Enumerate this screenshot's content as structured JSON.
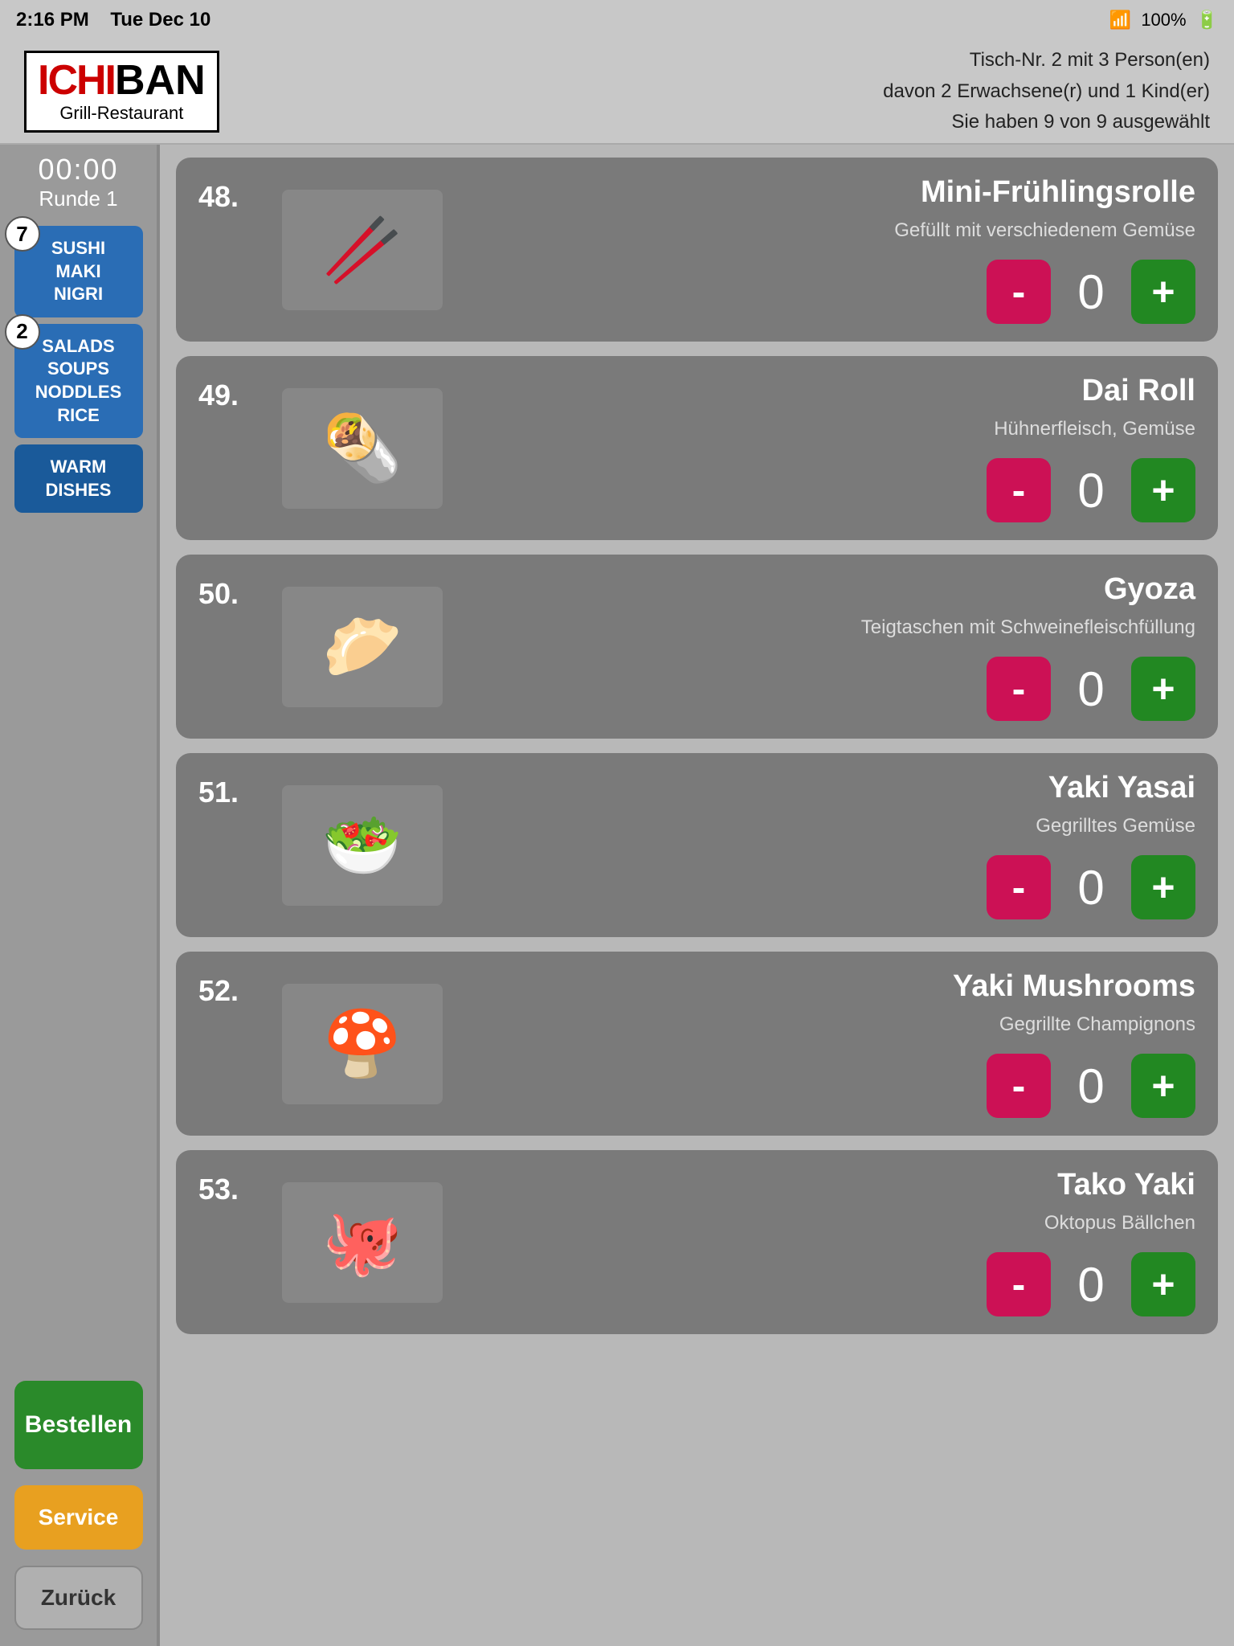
{
  "statusBar": {
    "time": "2:16 PM",
    "date": "Tue Dec 10",
    "wifi": "▲",
    "battery": "100%"
  },
  "header": {
    "logoIchi": "ICHI",
    "logoBan": "BAN",
    "logoSub": "Grill-Restaurant",
    "tableInfo": "Tisch-Nr. 2 mit 3 Person(en)",
    "tableDetails": "davon 2 Erwachsene(r) und 1 Kind(er)",
    "selectionInfo": "Sie haben 9 von 9 ausgewählt"
  },
  "sidebar": {
    "timer": "00:00",
    "round": "Runde 1",
    "categories": [
      {
        "id": "sushi",
        "badge": "7",
        "label": "SUSHI\nMAKI\nNIGRI",
        "active": false
      },
      {
        "id": "salads",
        "badge": "2",
        "label": "SALADS\nSOUPS\nNODDLES\nRICE",
        "active": false
      },
      {
        "id": "warm",
        "badge": "",
        "label": "WARM\nDISHES",
        "active": true
      }
    ],
    "bestellenLabel": "Bestellen",
    "serviceLabel": "Service",
    "zuruckLabel": "Zurück"
  },
  "menuItems": [
    {
      "number": "48.",
      "name": "Mini-Frühlingsrolle",
      "description": "Gefüllt mit verschiedenem Gemüse",
      "quantity": "0",
      "emoji": "🥢"
    },
    {
      "number": "49.",
      "name": "Dai Roll",
      "description": "Hühnerfleisch, Gemüse",
      "quantity": "0",
      "emoji": "🌯"
    },
    {
      "number": "50.",
      "name": "Gyoza",
      "description": "Teigtaschen mit Schweinefleischfüllung",
      "quantity": "0",
      "emoji": "🥟"
    },
    {
      "number": "51.",
      "name": "Yaki Yasai",
      "description": "Gegrilltes Gemüse",
      "quantity": "0",
      "emoji": "🥗"
    },
    {
      "number": "52.",
      "name": "Yaki Mushrooms",
      "description": "Gegrillte Champignons",
      "quantity": "0",
      "emoji": "🍄"
    },
    {
      "number": "53.",
      "name": "Tako Yaki",
      "description": "Oktopus Bällchen",
      "quantity": "0",
      "emoji": "🐙"
    }
  ],
  "controls": {
    "minusLabel": "-",
    "plusLabel": "+"
  }
}
